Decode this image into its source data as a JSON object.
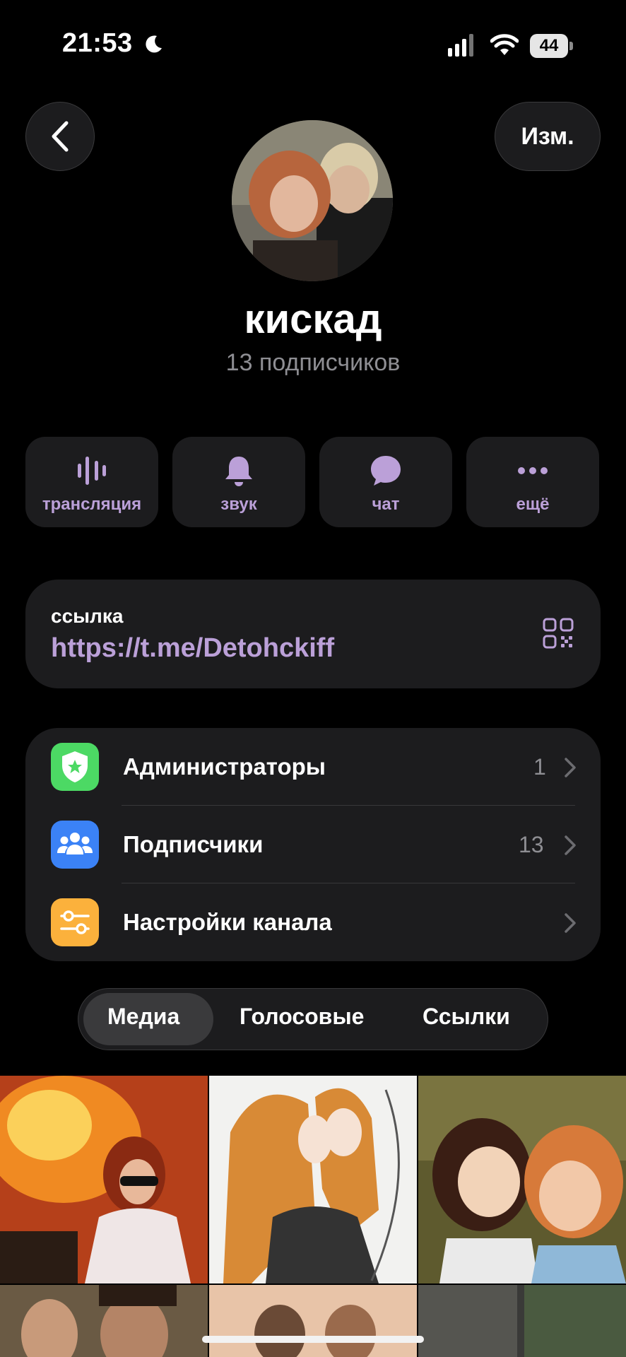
{
  "status_bar": {
    "time": "21:53",
    "battery": "44"
  },
  "header": {
    "edit_label": "Изм."
  },
  "profile": {
    "name": "кискад",
    "subscribers": "13 подписчиков"
  },
  "actions": [
    {
      "label": "трансляция",
      "icon": "live-waveform-icon"
    },
    {
      "label": "звук",
      "icon": "bell-icon"
    },
    {
      "label": "чат",
      "icon": "chat-bubble-icon"
    },
    {
      "label": "ещё",
      "icon": "more-dots-icon"
    }
  ],
  "link": {
    "caption": "ссылка",
    "url": "https://t.me/Detohckiff"
  },
  "settings": [
    {
      "label": "Администраторы",
      "value": "1",
      "icon": "admin-shield-icon",
      "color": "#4cd964"
    },
    {
      "label": "Подписчики",
      "value": "13",
      "icon": "people-icon",
      "color": "#3b82f6"
    },
    {
      "label": "Настройки канала",
      "value": "",
      "icon": "sliders-icon",
      "color": "#fbb13c"
    }
  ],
  "tabs": {
    "items": [
      "Медиа",
      "Голосовые",
      "Ссылки"
    ],
    "selected": "Медиа"
  },
  "colors": {
    "accent": "#bba0d8",
    "card": "#1c1c1e",
    "background": "#000000"
  }
}
